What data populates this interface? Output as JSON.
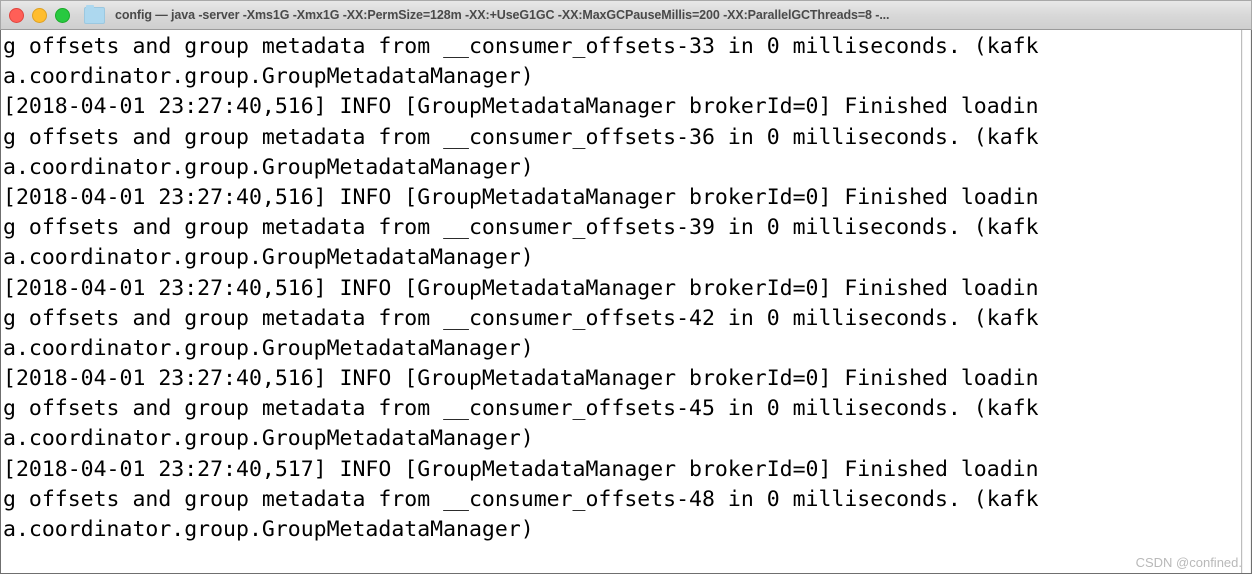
{
  "window": {
    "title": "config — java -server -Xms1G -Xmx1G -XX:PermSize=128m -XX:+UseG1GC -XX:MaxGCPauseMillis=200 -XX:ParallelGCThreads=8 -...",
    "controls": {
      "close_label": "close-button",
      "minimize_label": "minimize-button",
      "maximize_label": "maximize-button"
    },
    "folder_icon_name": "folder-icon"
  },
  "terminal": {
    "lines": [
      "g offsets and group metadata from __consumer_offsets-33 in 0 milliseconds. (kafk",
      "a.coordinator.group.GroupMetadataManager)",
      "[2018-04-01 23:27:40,516] INFO [GroupMetadataManager brokerId=0] Finished loadin",
      "g offsets and group metadata from __consumer_offsets-36 in 0 milliseconds. (kafk",
      "a.coordinator.group.GroupMetadataManager)",
      "[2018-04-01 23:27:40,516] INFO [GroupMetadataManager brokerId=0] Finished loadin",
      "g offsets and group metadata from __consumer_offsets-39 in 0 milliseconds. (kafk",
      "a.coordinator.group.GroupMetadataManager)",
      "[2018-04-01 23:27:40,516] INFO [GroupMetadataManager brokerId=0] Finished loadin",
      "g offsets and group metadata from __consumer_offsets-42 in 0 milliseconds. (kafk",
      "a.coordinator.group.GroupMetadataManager)",
      "[2018-04-01 23:27:40,516] INFO [GroupMetadataManager brokerId=0] Finished loadin",
      "g offsets and group metadata from __consumer_offsets-45 in 0 milliseconds. (kafk",
      "a.coordinator.group.GroupMetadataManager)",
      "[2018-04-01 23:27:40,517] INFO [GroupMetadataManager brokerId=0] Finished loadin",
      "g offsets and group metadata from __consumer_offsets-48 in 0 milliseconds. (kafk",
      "a.coordinator.group.GroupMetadataManager)"
    ]
  },
  "watermark": {
    "text": "CSDN @confined."
  },
  "colors": {
    "terminal_background": "#ffffff",
    "terminal_text": "#000000",
    "titlebar_background": "#d8d8d8",
    "titlebar_text": "#4a4a4a",
    "close_button": "#ff5f57",
    "minimize_button": "#ffbd2e",
    "maximize_button": "#28c940",
    "folder_icon": "#add8ef",
    "watermark_text": "#b9b9b9"
  }
}
